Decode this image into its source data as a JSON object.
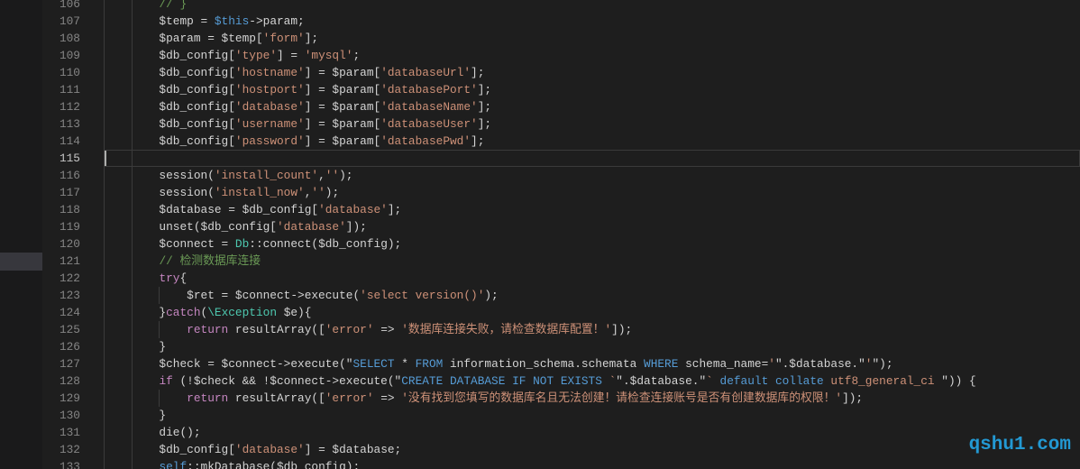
{
  "editor": {
    "language": "php",
    "current_line": 115,
    "gutter_marker_line": 121,
    "lines": [
      {
        "n": 106,
        "tokens": [
          [
            "p",
            "        "
          ],
          [
            "c",
            "// }"
          ]
        ]
      },
      {
        "n": 107,
        "tokens": [
          [
            "p",
            "        $temp = "
          ],
          [
            "t",
            "$this"
          ],
          [
            "p",
            "->param;"
          ]
        ]
      },
      {
        "n": 108,
        "tokens": [
          [
            "p",
            "        $param = $temp["
          ],
          [
            "s",
            "'form'"
          ],
          [
            "p",
            "];"
          ]
        ]
      },
      {
        "n": 109,
        "tokens": [
          [
            "p",
            "        $db_config["
          ],
          [
            "s",
            "'type'"
          ],
          [
            "p",
            "] = "
          ],
          [
            "s",
            "'mysql'"
          ],
          [
            "p",
            ";"
          ]
        ]
      },
      {
        "n": 110,
        "tokens": [
          [
            "p",
            "        $db_config["
          ],
          [
            "s",
            "'hostname'"
          ],
          [
            "p",
            "] = $param["
          ],
          [
            "s",
            "'databaseUrl'"
          ],
          [
            "p",
            "];"
          ]
        ]
      },
      {
        "n": 111,
        "tokens": [
          [
            "p",
            "        $db_config["
          ],
          [
            "s",
            "'hostport'"
          ],
          [
            "p",
            "] = $param["
          ],
          [
            "s",
            "'databasePort'"
          ],
          [
            "p",
            "];"
          ]
        ]
      },
      {
        "n": 112,
        "tokens": [
          [
            "p",
            "        $db_config["
          ],
          [
            "s",
            "'database'"
          ],
          [
            "p",
            "] = $param["
          ],
          [
            "s",
            "'databaseName'"
          ],
          [
            "p",
            "];"
          ]
        ]
      },
      {
        "n": 113,
        "tokens": [
          [
            "p",
            "        $db_config["
          ],
          [
            "s",
            "'username'"
          ],
          [
            "p",
            "] = $param["
          ],
          [
            "s",
            "'databaseUser'"
          ],
          [
            "p",
            "];"
          ]
        ]
      },
      {
        "n": 114,
        "tokens": [
          [
            "p",
            "        $db_config["
          ],
          [
            "s",
            "'password'"
          ],
          [
            "p",
            "] = $param["
          ],
          [
            "s",
            "'databasePwd'"
          ],
          [
            "p",
            "];"
          ]
        ]
      },
      {
        "n": 115,
        "tokens": []
      },
      {
        "n": 116,
        "tokens": [
          [
            "p",
            "        session("
          ],
          [
            "s",
            "'install_count'"
          ],
          [
            "p",
            ","
          ],
          [
            "s",
            "''"
          ],
          [
            "p",
            ");"
          ]
        ]
      },
      {
        "n": 117,
        "tokens": [
          [
            "p",
            "        session("
          ],
          [
            "s",
            "'install_now'"
          ],
          [
            "p",
            ","
          ],
          [
            "s",
            "''"
          ],
          [
            "p",
            ");"
          ]
        ]
      },
      {
        "n": 118,
        "tokens": [
          [
            "p",
            "        $database = $db_config["
          ],
          [
            "s",
            "'database'"
          ],
          [
            "p",
            "];"
          ]
        ]
      },
      {
        "n": 119,
        "tokens": [
          [
            "p",
            "        unset($db_config["
          ],
          [
            "s",
            "'database'"
          ],
          [
            "p",
            "]);"
          ]
        ]
      },
      {
        "n": 120,
        "tokens": [
          [
            "p",
            "        $connect = "
          ],
          [
            "cl",
            "Db"
          ],
          [
            "p",
            "::connect($db_config);"
          ]
        ]
      },
      {
        "n": 121,
        "tokens": [
          [
            "p",
            "        "
          ],
          [
            "c",
            "// 检测数据库连接"
          ]
        ]
      },
      {
        "n": 122,
        "tokens": [
          [
            "p",
            "        "
          ],
          [
            "k",
            "try"
          ],
          [
            "p",
            "{"
          ]
        ]
      },
      {
        "n": 123,
        "tokens": [
          [
            "p",
            "            $ret = $connect->execute("
          ],
          [
            "s",
            "'select version()'"
          ],
          [
            "p",
            ");"
          ]
        ]
      },
      {
        "n": 124,
        "tokens": [
          [
            "p",
            "        }"
          ],
          [
            "k",
            "catch"
          ],
          [
            "p",
            "("
          ],
          [
            "cl",
            "\\Exception"
          ],
          [
            "p",
            " $e){"
          ]
        ]
      },
      {
        "n": 125,
        "tokens": [
          [
            "p",
            "            "
          ],
          [
            "k",
            "return"
          ],
          [
            "p",
            " resultArray(["
          ],
          [
            "s",
            "'error'"
          ],
          [
            "p",
            " => "
          ],
          [
            "s",
            "'数据库连接失败，请检查数据库配置！'"
          ],
          [
            "p",
            "]);"
          ]
        ]
      },
      {
        "n": 126,
        "tokens": [
          [
            "p",
            "        }"
          ]
        ]
      },
      {
        "n": 127,
        "tokens": [
          [
            "p",
            "        $check = $connect->execute(\""
          ],
          [
            "q",
            "SELECT"
          ],
          [
            "p",
            " * "
          ],
          [
            "q",
            "FROM"
          ],
          [
            "p",
            " information_schema.schemata "
          ],
          [
            "q",
            "WHERE"
          ],
          [
            "p",
            " schema_name="
          ],
          [
            "s",
            "'"
          ],
          [
            "p",
            "\".$database.\""
          ],
          [
            "s",
            "'"
          ],
          [
            "p",
            "\");"
          ]
        ]
      },
      {
        "n": 128,
        "tokens": [
          [
            "p",
            "        "
          ],
          [
            "k",
            "if"
          ],
          [
            "p",
            " (!$check && !$connect->execute(\""
          ],
          [
            "q",
            "CREATE DATABASE IF NOT EXISTS"
          ],
          [
            "p",
            " "
          ],
          [
            "s",
            "`"
          ],
          [
            "p",
            "\".$database.\""
          ],
          [
            "s",
            "`"
          ],
          [
            "p",
            " "
          ],
          [
            "q",
            "default collate"
          ],
          [
            "p",
            " "
          ],
          [
            "s",
            "utf8_general_ci"
          ],
          [
            "p",
            " \")) {"
          ]
        ]
      },
      {
        "n": 129,
        "tokens": [
          [
            "p",
            "            "
          ],
          [
            "k",
            "return"
          ],
          [
            "p",
            " resultArray(["
          ],
          [
            "s",
            "'error'"
          ],
          [
            "p",
            " => "
          ],
          [
            "s",
            "'没有找到您填写的数据库名且无法创建！请检查连接账号是否有创建数据库的权限！'"
          ],
          [
            "p",
            "]);"
          ]
        ]
      },
      {
        "n": 130,
        "tokens": [
          [
            "p",
            "        }"
          ]
        ]
      },
      {
        "n": 131,
        "tokens": [
          [
            "p",
            "        die();"
          ]
        ]
      },
      {
        "n": 132,
        "tokens": [
          [
            "p",
            "        $db_config["
          ],
          [
            "s",
            "'database'"
          ],
          [
            "p",
            "] = $database;"
          ]
        ]
      },
      {
        "n": 133,
        "tokens": [
          [
            "p",
            "        "
          ],
          [
            "t",
            "self"
          ],
          [
            "p",
            "::mkDatabase($db_config);"
          ]
        ]
      }
    ]
  },
  "syntax_colors": {
    "p": "#d4d4d4",
    "s": "#ce9178",
    "c": "#6a9955",
    "k": "#c586c0",
    "t": "#569cd6",
    "q": "#569cd6",
    "cl": "#4ec9b0"
  },
  "watermark": "qshu1.com"
}
